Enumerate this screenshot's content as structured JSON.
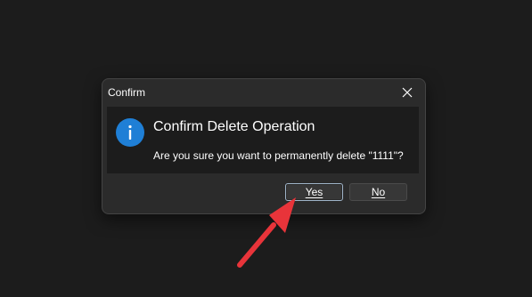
{
  "window": {
    "title": "Confirm",
    "close_icon": "close-icon"
  },
  "message": {
    "icon": "info-icon",
    "heading": "Confirm Delete Operation",
    "body": "Are you sure you want to permanently delete \"1111\"?"
  },
  "buttons": {
    "yes_label": "Yes",
    "no_label": "No"
  },
  "annotation": {
    "icon": "red-arrow-icon"
  },
  "colors": {
    "background": "#1c1c1c",
    "dialog": "#2b2b2b",
    "content_panel": "#1c1c1c",
    "info_icon": "#1f7fd6",
    "arrow": "#e8343a",
    "focused_button_border": "#9fb4c8"
  }
}
